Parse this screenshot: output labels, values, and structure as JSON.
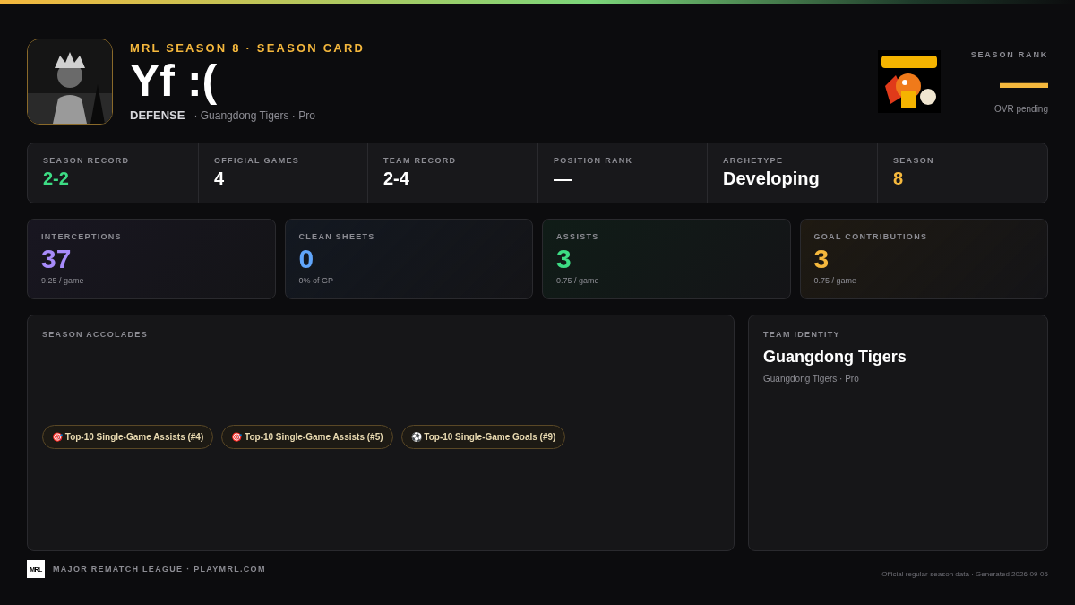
{
  "header": {
    "eyebrow": "MRL SEASON 8 · SEASON CARD",
    "player_name": "Yf :(",
    "position": "DEFENSE",
    "team_line": "· Guangdong Tigers · Pro"
  },
  "rank": {
    "label": "SEASON RANK",
    "value": "—",
    "note": "OVR pending"
  },
  "summary": [
    {
      "label": "SEASON RECORD",
      "value": "2-2",
      "color": "#3ddc84"
    },
    {
      "label": "OFFICIAL GAMES",
      "value": "4",
      "color": "#ffffff"
    },
    {
      "label": "TEAM RECORD",
      "value": "2-4",
      "color": "#ffffff"
    },
    {
      "label": "POSITION RANK",
      "value": "—",
      "color": "#ffffff"
    },
    {
      "label": "ARCHETYPE",
      "value": "Developing",
      "color": "#ffffff"
    },
    {
      "label": "SEASON",
      "value": "8",
      "color": "#f5b83d"
    }
  ],
  "stats": [
    {
      "label": "INTERCEPTIONS",
      "value": "37",
      "sub": "9.25 / game",
      "color": "#a78bfa"
    },
    {
      "label": "CLEAN SHEETS",
      "value": "0",
      "sub": "0% of GP",
      "color": "#60a5fa"
    },
    {
      "label": "ASSISTS",
      "value": "3",
      "sub": "0.75 / game",
      "color": "#3ddc84"
    },
    {
      "label": "GOAL CONTRIBUTIONS",
      "value": "3",
      "sub": "0.75 / game",
      "color": "#f5b83d"
    }
  ],
  "accolades": {
    "title": "SEASON ACCOLADES",
    "items": [
      "🎯 Top-10 Single-Game Assists (#4)",
      "🎯 Top-10 Single-Game Assists (#5)",
      "⚽ Top-10 Single-Game Goals (#9)"
    ]
  },
  "team_identity": {
    "title": "TEAM IDENTITY",
    "name": "Guangdong Tigers",
    "sub": "Guangdong Tigers · Pro"
  },
  "footer": {
    "logo": "MRL",
    "left": "MAJOR REMATCH LEAGUE · PLAYMRL.COM",
    "right": "Official regular-season data · Generated 2026-09-05"
  }
}
